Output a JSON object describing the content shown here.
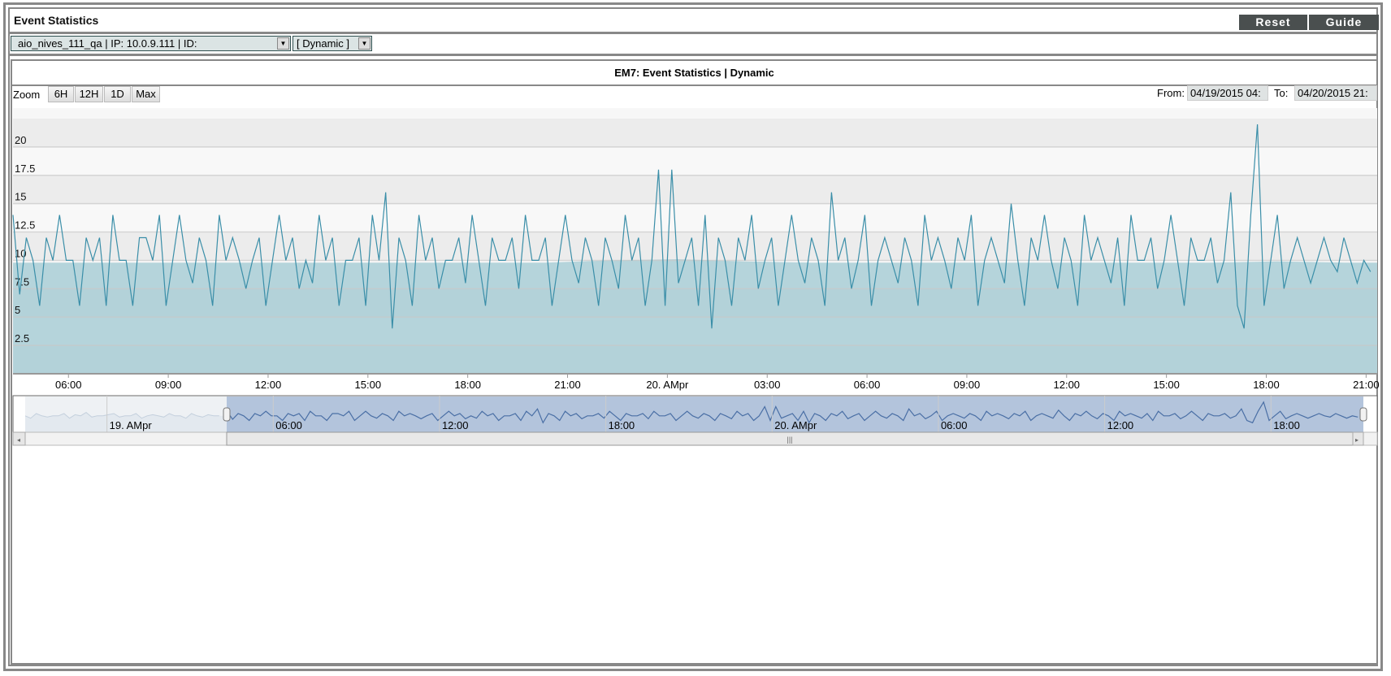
{
  "header": {
    "title": "Event Statistics",
    "reset_label": "Reset",
    "guide_label": "Guide"
  },
  "selectors": {
    "device": "aio_nives_111_qa | IP: 10.0.9.111 | ID:",
    "mode": "[ Dynamic ]"
  },
  "chart_panel": {
    "title": "EM7: Event Statistics | Dynamic",
    "zoom_label": "Zoom",
    "zoom_buttons": [
      "6H",
      "12H",
      "1D",
      "Max"
    ],
    "from_label": "From:",
    "from_value": "04/19/2015 04:",
    "to_label": "To:",
    "to_value": "04/20/2015 21:"
  },
  "chart_data": {
    "type": "line",
    "title": "EM7: Event Statistics | Dynamic",
    "xlabel": "",
    "ylabel": "",
    "ylim": [
      0,
      22.5
    ],
    "yticks": [
      "2.5",
      "5",
      "7.5",
      "10",
      "12.5",
      "15",
      "17.5",
      "20"
    ],
    "xticks": [
      "06:00",
      "09:00",
      "12:00",
      "15:00",
      "18:00",
      "21:00",
      "20. AMpr",
      "03:00",
      "06:00",
      "09:00",
      "12:00",
      "15:00",
      "18:00",
      "21:00"
    ],
    "x_range": [
      "2015-04-19 04:20",
      "2015-04-20 21:20"
    ],
    "grid": true,
    "alternating_bands": true,
    "colors": {
      "line": "#3a8ea8",
      "area": "#a9ced6",
      "navigator": "#4a6fa5",
      "navigator_fill": "#b3c4dc"
    },
    "series": [
      {
        "start": "2015-04-19 04:20",
        "step_minutes": 12,
        "values": [
          14,
          7,
          12,
          10,
          6,
          12,
          10,
          14,
          10,
          10,
          6,
          12,
          10,
          12,
          6,
          14,
          10,
          10,
          6,
          12,
          12,
          10,
          14,
          6,
          10,
          14,
          10,
          8,
          12,
          10,
          6,
          14,
          10,
          12,
          10,
          7.5,
          10,
          12,
          6,
          10,
          14,
          10,
          12,
          7.5,
          10,
          8,
          14,
          10,
          12,
          6,
          10,
          10,
          12,
          6,
          14,
          10,
          16,
          4,
          12,
          10,
          6,
          14,
          10,
          12,
          7.5,
          10,
          10,
          12,
          8,
          14,
          10,
          6,
          12,
          10,
          10,
          12,
          7.5,
          14,
          10,
          10,
          12,
          6,
          10,
          14,
          10,
          8,
          12,
          10,
          6,
          12,
          10,
          7.5,
          14,
          10,
          12,
          6,
          10,
          18,
          6,
          18,
          8,
          10,
          12,
          6,
          14,
          4,
          12,
          10,
          6,
          12,
          10,
          14,
          7.5,
          10,
          12,
          6,
          10,
          14,
          10,
          8,
          12,
          10,
          6,
          16,
          10,
          12,
          7.5,
          10,
          14,
          6,
          10,
          12,
          10,
          8,
          12,
          10,
          6,
          14,
          10,
          12,
          10,
          7.5,
          12,
          10,
          14,
          6,
          10,
          12,
          10,
          8,
          15,
          10,
          6,
          12,
          10,
          14,
          10,
          7.5,
          12,
          10,
          6,
          14,
          10,
          12,
          10,
          8,
          12,
          6,
          14,
          10,
          10,
          12,
          7.5,
          10,
          14,
          10,
          6,
          12,
          10,
          10,
          12,
          8,
          10,
          16,
          6,
          4,
          14,
          22,
          6,
          10,
          14,
          7.5,
          10,
          12,
          10,
          8,
          10,
          12,
          10,
          9,
          12,
          10,
          8,
          10,
          9
        ]
      },
      {
        "type": "area",
        "start": "2015-04-19 04:20",
        "step_minutes": 120,
        "values": [
          9.8,
          9.8,
          9.8,
          9.8,
          9.8,
          9.8,
          9.8,
          9.8,
          9.8,
          10,
          10.1,
          9.9,
          9.8,
          9.8,
          9.8,
          9.8,
          9.8,
          9.8,
          9.8,
          9.9,
          9.8
        ]
      }
    ],
    "navigator": {
      "xticks": [
        "19. AMpr",
        "06:00",
        "12:00",
        "18:00",
        "20. AMpr",
        "06:00",
        "12:00",
        "18:00"
      ],
      "pre_values": [
        10,
        8,
        12,
        10,
        9,
        10,
        10,
        12,
        8,
        11,
        10,
        13,
        9,
        10,
        10,
        11,
        12,
        9,
        10,
        10,
        12,
        8,
        10,
        11,
        10,
        9,
        12,
        10,
        10,
        8,
        12,
        10,
        9,
        11,
        10,
        10
      ]
    }
  }
}
